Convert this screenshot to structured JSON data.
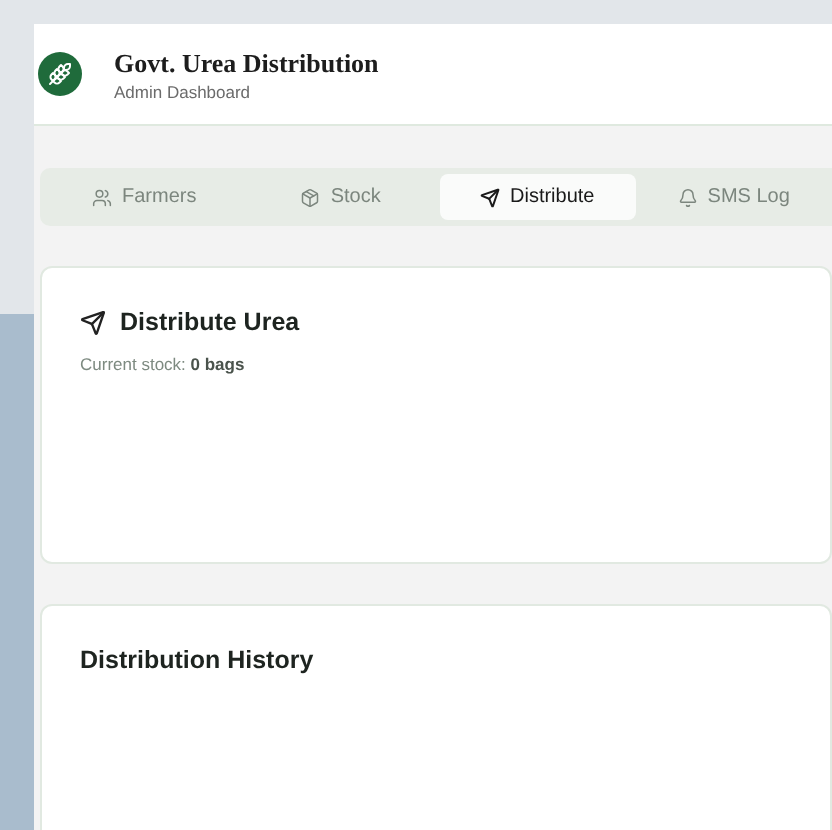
{
  "header": {
    "title": "Govt. Urea Distribution",
    "subtitle": "Admin Dashboard"
  },
  "tabs": [
    {
      "label": "Farmers",
      "selected": false
    },
    {
      "label": "Stock",
      "selected": false
    },
    {
      "label": "Distribute",
      "selected": true
    },
    {
      "label": "SMS Log",
      "selected": false
    }
  ],
  "distribute_card": {
    "title": "Distribute Urea",
    "stock_label": "Current stock:",
    "stock_value": "0 bags"
  },
  "history_card": {
    "title": "Distribution History"
  }
}
